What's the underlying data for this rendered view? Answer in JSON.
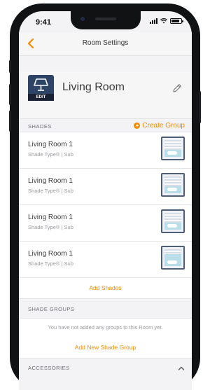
{
  "status_bar": {
    "time": "9:41"
  },
  "nav": {
    "title": "Room Settings"
  },
  "room": {
    "name": "Living Room",
    "icon_badge": "EDIT"
  },
  "shades_section": {
    "label": "SHADES",
    "create_group_label": "Create Group",
    "items": [
      {
        "name": "Living Room 1",
        "type": "Shade Type® | Sub",
        "icon": "shade-closed-icon"
      },
      {
        "name": "Living Room 1",
        "type": "Shade Type® | Sub",
        "icon": "shade-closed-icon"
      },
      {
        "name": "Living Room 1",
        "type": "Shade Type® | Sub",
        "icon": "shade-closed-icon"
      },
      {
        "name": "Living Room 1",
        "type": "Shade Type® | Sub",
        "icon": "shade-open-icon"
      }
    ],
    "add_label": "Add Shades"
  },
  "shade_groups": {
    "label": "SHADE GROUPS",
    "empty_message": "You have not added any groups to this Room yet.",
    "add_label": "Add New Shade Group"
  },
  "accessories": {
    "label": "ACCESSORIES"
  },
  "colors": {
    "accent": "#f28c00",
    "icon_navy": "#2d4467",
    "frame": "#111214"
  }
}
